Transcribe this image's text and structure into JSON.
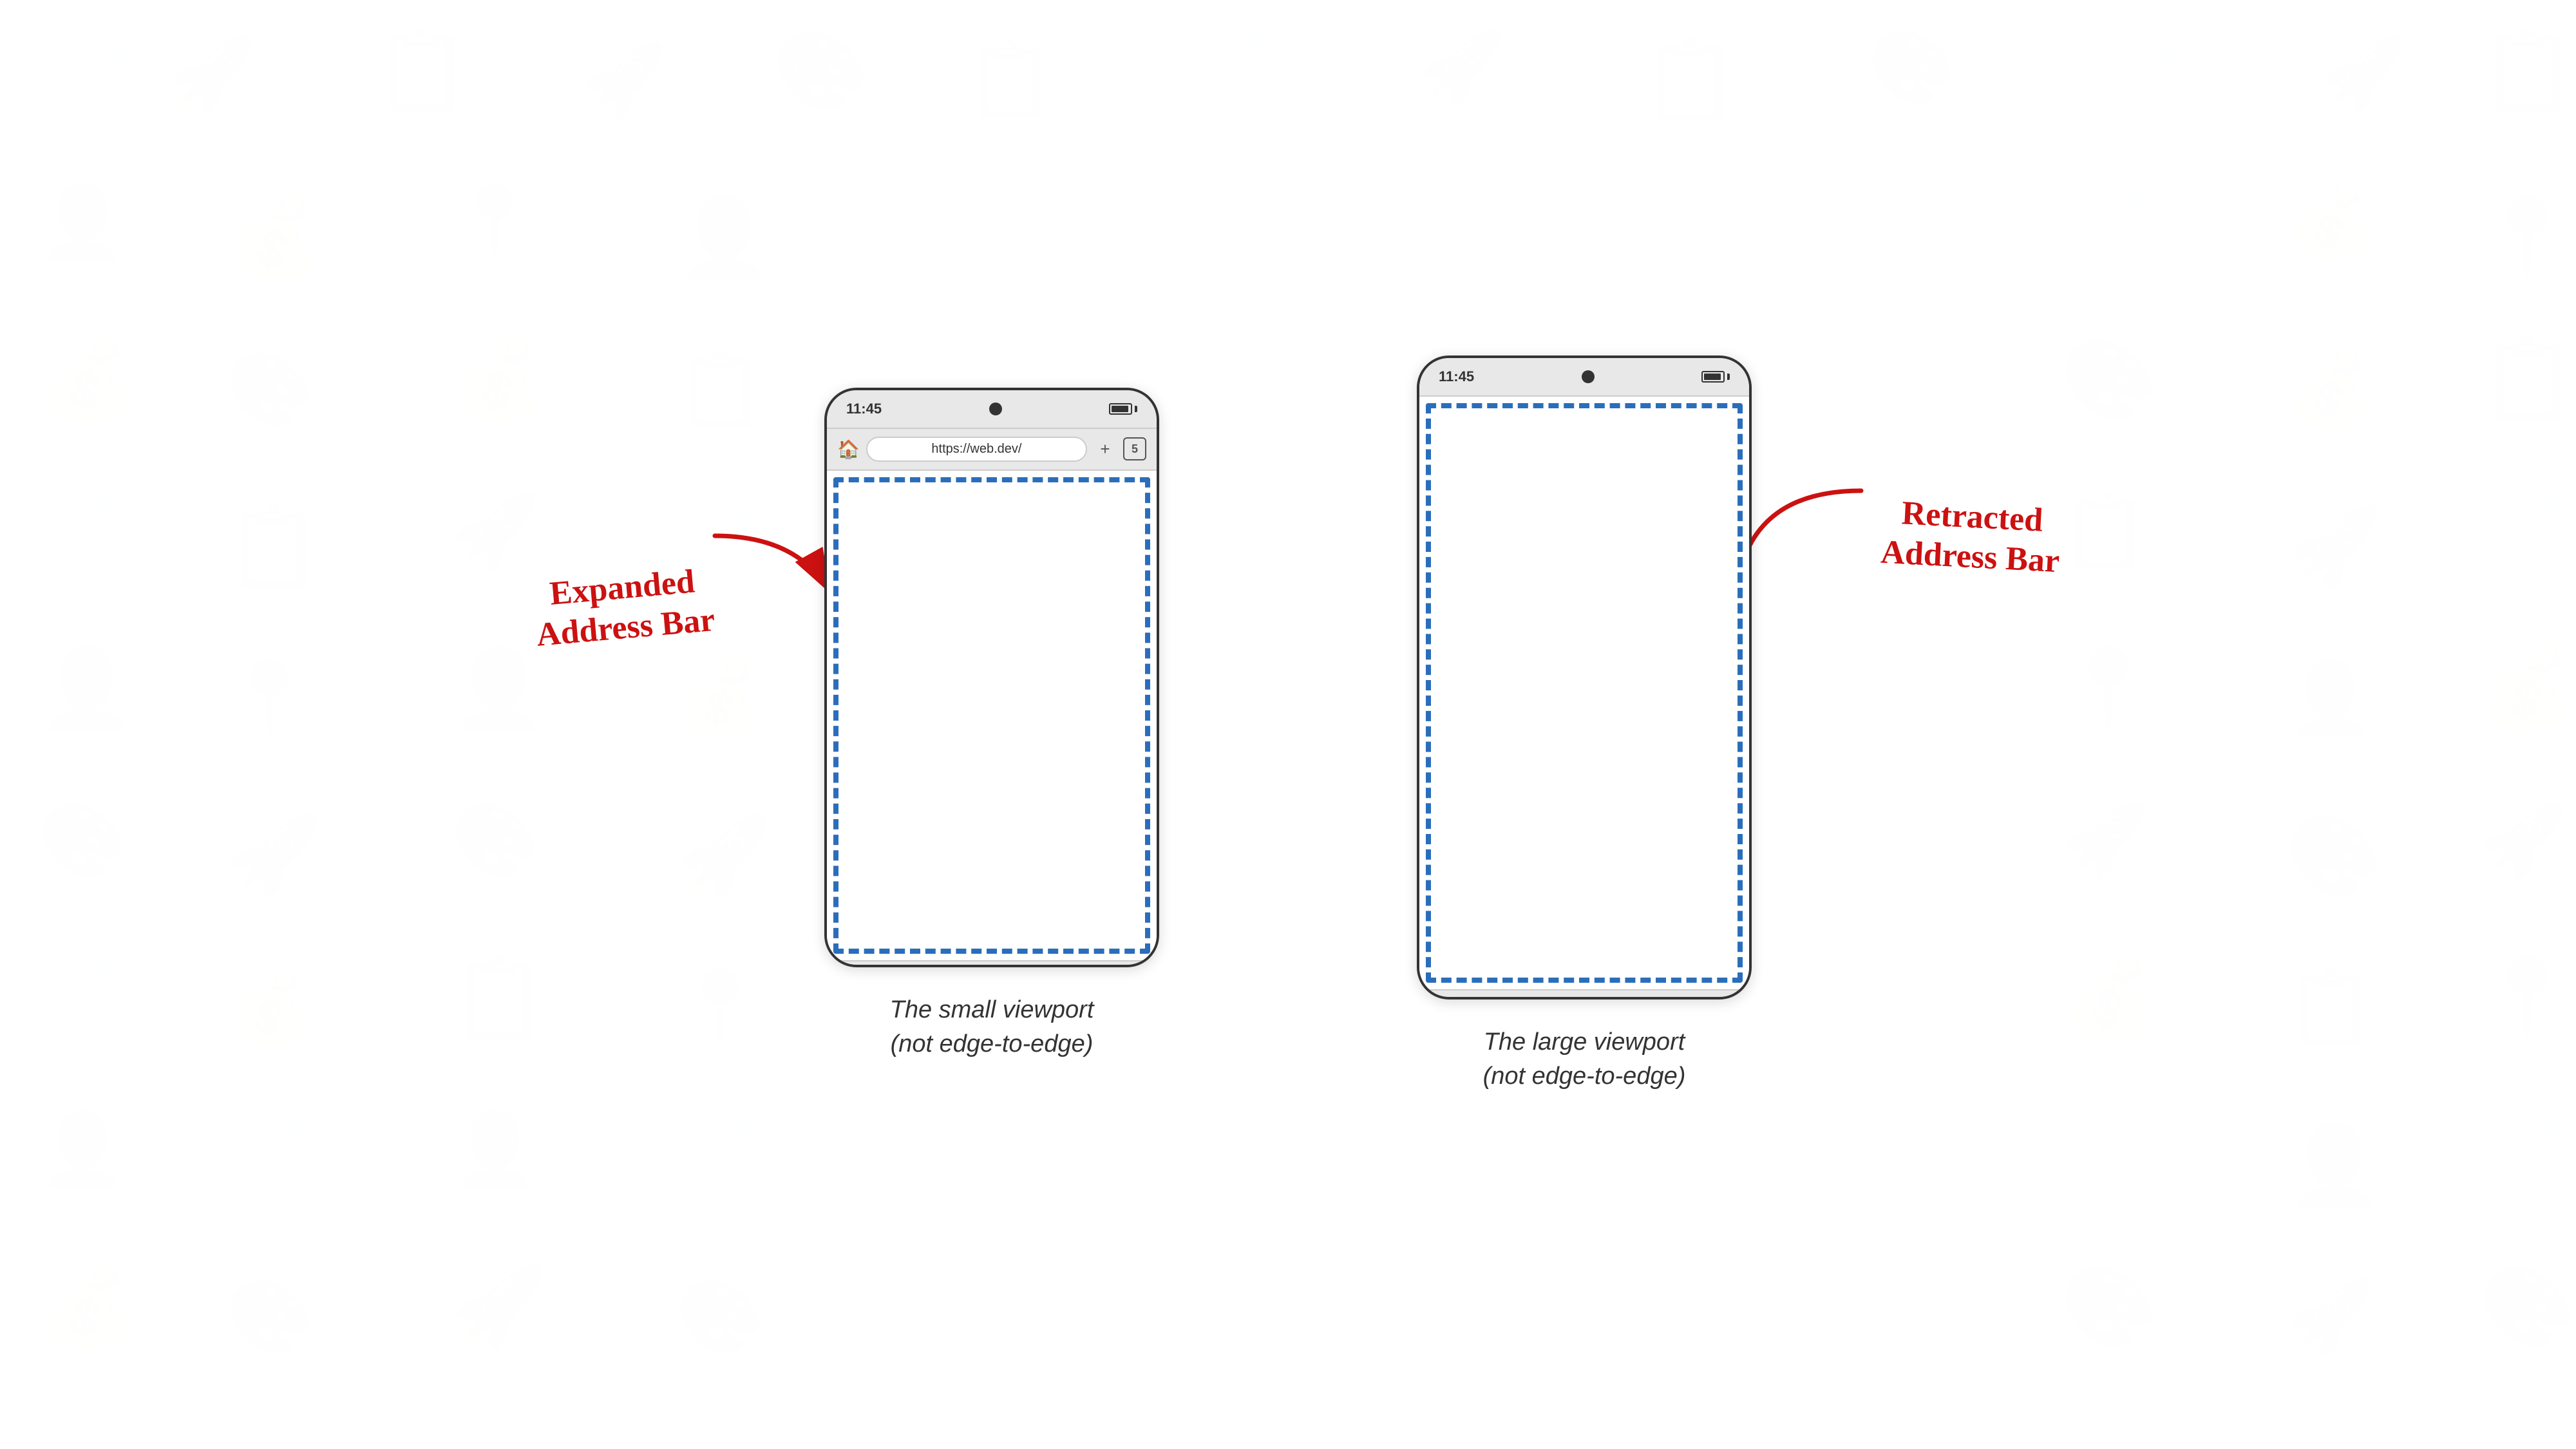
{
  "background": {
    "color": "#ffffff"
  },
  "left_phone": {
    "status_time": "11:45",
    "url": "https://web.dev/",
    "tabs_count": "5",
    "label": "Expanded\nAddress Bar",
    "caption_line1": "The small viewport",
    "caption_line2": "(not edge-to-edge)"
  },
  "right_phone": {
    "status_time": "11:45",
    "label_line1": "Retracted",
    "label_line2": "Address Bar",
    "caption_line1": "The large viewport",
    "caption_line2": "(not edge-to-edge)"
  },
  "label_color": "#cc1111",
  "viewport_border_color": "#2a6ebb"
}
